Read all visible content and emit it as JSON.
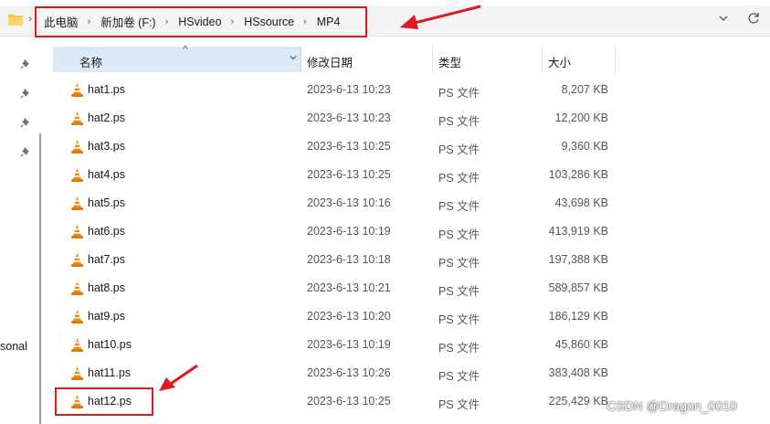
{
  "address_bar": {
    "crumbs": [
      "此电脑",
      "新加卷 (F:)",
      "HSvideo",
      "HSsource",
      "MP4"
    ]
  },
  "sidebar": {
    "partial_label": "sonal"
  },
  "columns": {
    "name": "名称",
    "date": "修改日期",
    "type": "类型",
    "size": "大小"
  },
  "files": [
    {
      "name": "hat1.ps",
      "date": "2023-6-13 10:23",
      "type": "PS 文件",
      "size": "8,207 KB"
    },
    {
      "name": "hat2.ps",
      "date": "2023-6-13 10:23",
      "type": "PS 文件",
      "size": "12,200 KB"
    },
    {
      "name": "hat3.ps",
      "date": "2023-6-13 10:25",
      "type": "PS 文件",
      "size": "9,360 KB"
    },
    {
      "name": "hat4.ps",
      "date": "2023-6-13 10:25",
      "type": "PS 文件",
      "size": "103,286 KB"
    },
    {
      "name": "hat5.ps",
      "date": "2023-6-13 10:16",
      "type": "PS 文件",
      "size": "43,698 KB"
    },
    {
      "name": "hat6.ps",
      "date": "2023-6-13 10:19",
      "type": "PS 文件",
      "size": "413,919 KB"
    },
    {
      "name": "hat7.ps",
      "date": "2023-6-13 10:18",
      "type": "PS 文件",
      "size": "197,388 KB"
    },
    {
      "name": "hat8.ps",
      "date": "2023-6-13 10:21",
      "type": "PS 文件",
      "size": "589,857 KB"
    },
    {
      "name": "hat9.ps",
      "date": "2023-6-13 10:20",
      "type": "PS 文件",
      "size": "186,129 KB"
    },
    {
      "name": "hat10.ps",
      "date": "2023-6-13 10:19",
      "type": "PS 文件",
      "size": "45,860 KB"
    },
    {
      "name": "hat11.ps",
      "date": "2023-6-13 10:26",
      "type": "PS 文件",
      "size": "383,408 KB"
    },
    {
      "name": "hat12.ps",
      "date": "2023-6-13 10:25",
      "type": "PS 文件",
      "size": "225,429 KB"
    }
  ],
  "watermark": "CSDN @Dragon_0010",
  "colors": {
    "annotation": "#e0191f",
    "header_selected": "#dbe9f9",
    "vlc_orange": "#f08a12"
  },
  "icons": {
    "folder": "folder-icon",
    "file": "vlc-cone-icon",
    "pin": "pin-icon",
    "refresh": "refresh-icon",
    "dropdown": "chevron-down-icon"
  }
}
